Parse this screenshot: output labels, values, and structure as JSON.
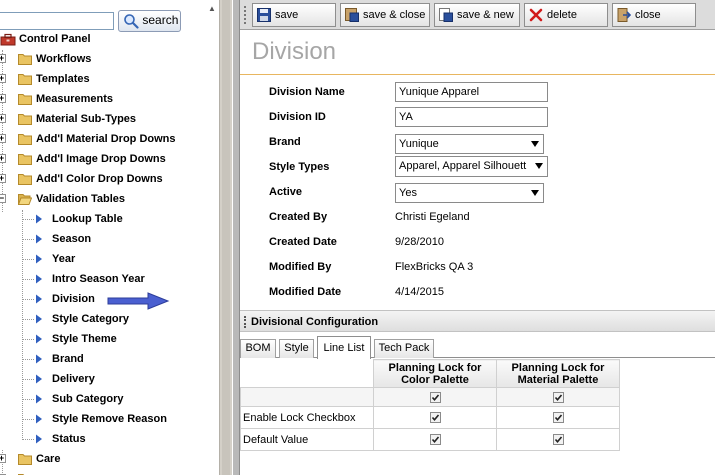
{
  "search": {
    "value": "",
    "button_label": "search"
  },
  "tree": {
    "root": {
      "label": "Control Panel"
    },
    "items": [
      {
        "label": "Workflows",
        "type": "folder"
      },
      {
        "label": "Templates",
        "type": "folder"
      },
      {
        "label": "Measurements",
        "type": "folder"
      },
      {
        "label": "Material Sub-Types",
        "type": "folder"
      },
      {
        "label": "Add'l Material Drop Downs",
        "type": "folder"
      },
      {
        "label": "Add'l Image Drop Downs",
        "type": "folder"
      },
      {
        "label": "Add'l Color Drop Downs",
        "type": "folder"
      },
      {
        "label": "Validation Tables",
        "type": "folder-open"
      }
    ],
    "validation_children": [
      "Lookup Table",
      "Season",
      "Year",
      "Intro Season Year",
      "Division",
      "Style Category",
      "Style Theme",
      "Brand",
      "Delivery",
      "Sub Category",
      "Style Remove Reason",
      "Status"
    ],
    "after": [
      {
        "label": "Care",
        "type": "folder"
      }
    ]
  },
  "toolbar": {
    "save": "save",
    "save_close": "save & close",
    "save_new": "save & new",
    "delete": "delete",
    "close": "close"
  },
  "page": {
    "title": "Division"
  },
  "form": {
    "division_name": {
      "label": "Division Name",
      "value": "Yunique Apparel"
    },
    "division_id": {
      "label": "Division ID",
      "value": "YA"
    },
    "brand": {
      "label": "Brand",
      "value": "Yunique"
    },
    "style_types": {
      "label": "Style Types",
      "value": "Apparel, Apparel Silhouett"
    },
    "active": {
      "label": "Active",
      "value": "Yes"
    },
    "created_by": {
      "label": "Created By",
      "value": "Christi Egeland"
    },
    "created_date": {
      "label": "Created Date",
      "value": "9/28/2010"
    },
    "modified_by": {
      "label": "Modified By",
      "value": "FlexBricks QA 3"
    },
    "modified_date": {
      "label": "Modified Date",
      "value": "4/14/2015"
    }
  },
  "section": {
    "title": "Divisional Configuration"
  },
  "tabs": [
    {
      "label": "BOM",
      "active": false
    },
    {
      "label": "Style",
      "active": false
    },
    {
      "label": "Line List",
      "active": true
    },
    {
      "label": "Tech Pack",
      "active": false
    }
  ],
  "grid": {
    "columns": [
      {
        "line1": "Planning Lock for",
        "line2": "Color Palette"
      },
      {
        "line1": "Planning Lock for",
        "line2": "Material Palette"
      }
    ],
    "rows": [
      {
        "label": "",
        "values": [
          true,
          true
        ]
      },
      {
        "label": "Enable Lock Checkbox",
        "values": [
          true,
          true
        ]
      },
      {
        "label": "Default Value",
        "values": [
          true,
          true
        ]
      }
    ]
  },
  "colors": {
    "title_gray": "#a6a6a6",
    "title_rule": "#e8b660",
    "tree_arrow": "#2f5fbf",
    "callout_arrow": "#4a5fd0",
    "folder": "#e9c462"
  }
}
